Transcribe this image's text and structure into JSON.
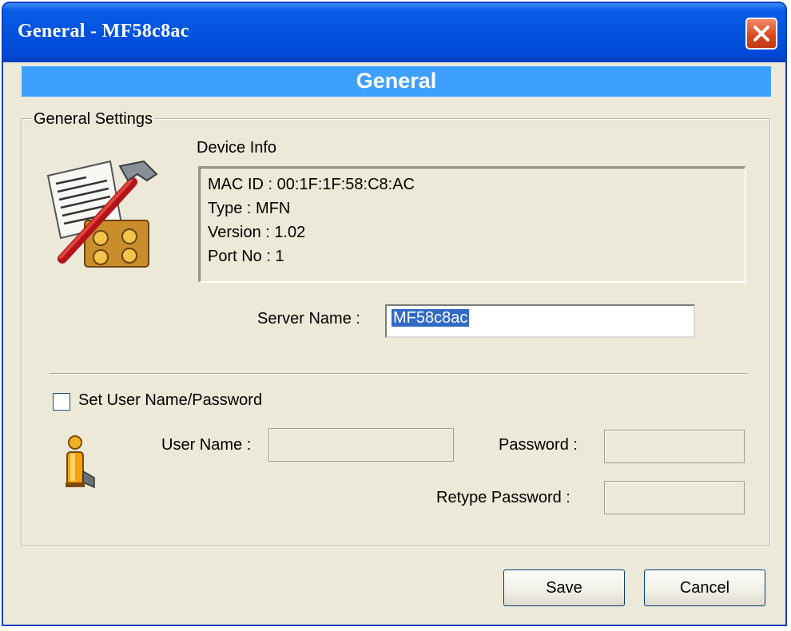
{
  "window": {
    "title": "General - MF58c8ac",
    "header": "General"
  },
  "group": {
    "legend": "General Settings"
  },
  "device_info": {
    "label": "Device Info",
    "lines": [
      "MAC ID : 00:1F:1F:58:C8:AC",
      "Type : MFN",
      "Version : 1.02",
      "Port No : 1"
    ]
  },
  "server_name": {
    "label": "Server Name :",
    "value": "MF58c8ac"
  },
  "credentials": {
    "checkbox_label": "Set User Name/Password",
    "checkbox_checked": false,
    "user_name_label": "User Name :",
    "password_label": "Password :",
    "retype_password_label": "Retype Password :",
    "user_name_value": "",
    "password_value": "",
    "retype_password_value": ""
  },
  "buttons": {
    "save": "Save",
    "cancel": "Cancel"
  },
  "colors": {
    "titlebar": "#0453dd",
    "header_bar": "#3ea0fd",
    "dialog_bg": "#ece9d8",
    "selection": "#316ac5"
  },
  "icons": {
    "close": "close-icon",
    "settings": "settings-tools-icon",
    "user": "user-icon"
  }
}
